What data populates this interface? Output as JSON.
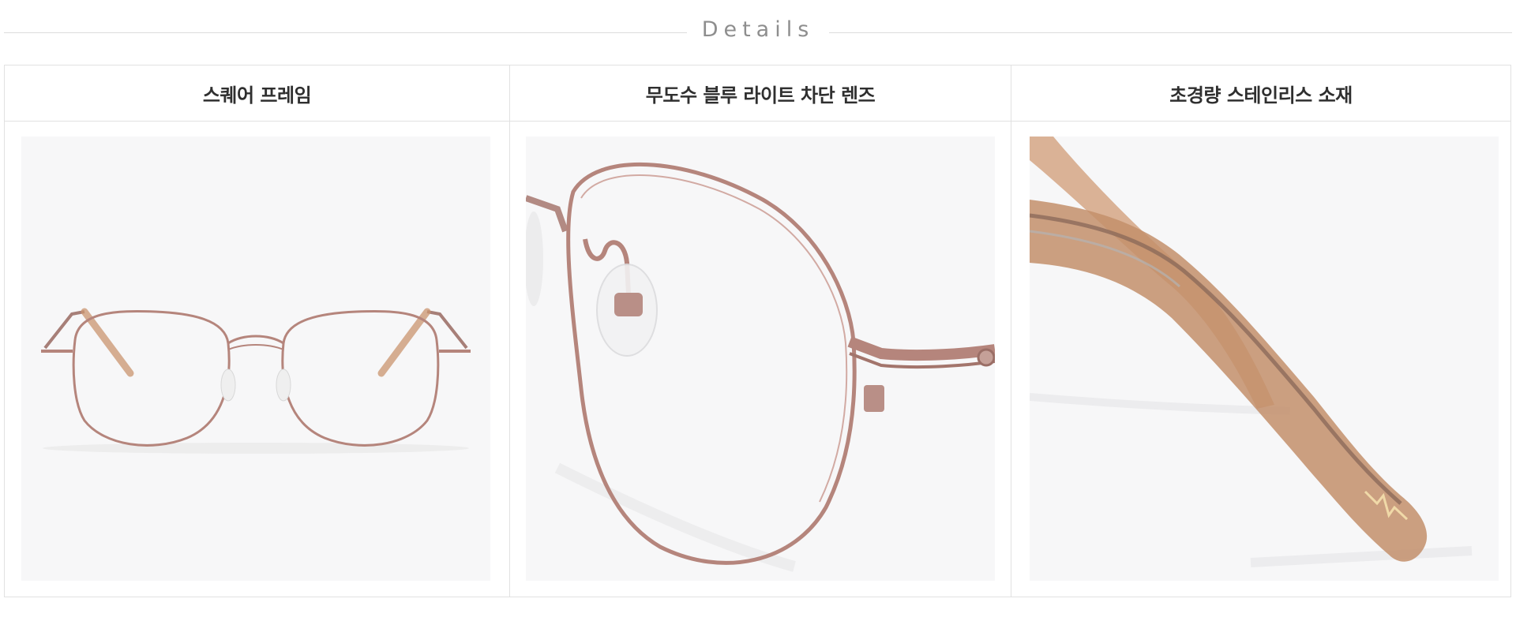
{
  "header": {
    "title": "Details"
  },
  "columns": [
    {
      "label": "스퀘어 프레임",
      "image": "front-view-of-rose-gold-round-glasses"
    },
    {
      "label": "무도수 블루 라이트 차단 렌즈",
      "image": "close-up-of-lens-and-nose-pad"
    },
    {
      "label": "초경량 스테인리스 소재",
      "image": "close-up-of-temple-tip"
    }
  ],
  "colors": {
    "frame": "#b5857c",
    "temple": "#c7926d",
    "heading": "#2f2f2f",
    "title": "#8e8e8e",
    "border": "#e1e1e1",
    "photo_bg": "#f7f7f8"
  }
}
